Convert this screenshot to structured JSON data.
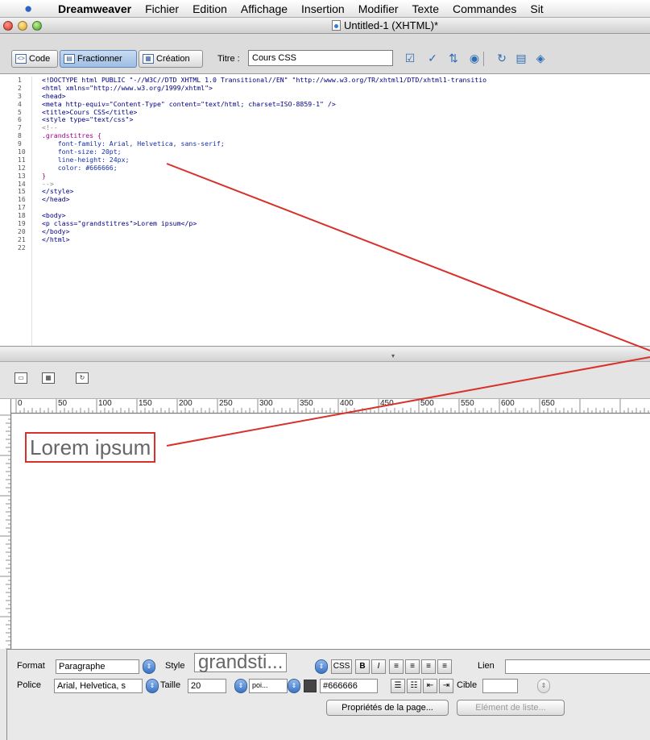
{
  "menubar": {
    "items": [
      "Dreamweaver",
      "Fichier",
      "Edition",
      "Affichage",
      "Insertion",
      "Modifier",
      "Texte",
      "Commandes",
      "Sit"
    ]
  },
  "window": {
    "title": "Untitled-1 (XHTML)*"
  },
  "doc_toolbar": {
    "code_label": "Code",
    "split_label": "Fractionner",
    "design_label": "Création",
    "title_label": "Titre :",
    "title_value": "Cours CSS"
  },
  "code": {
    "line_numbers": [
      "1",
      "2",
      "3",
      "4",
      "5",
      "6",
      "7",
      "8",
      "9",
      "10",
      "11",
      "12",
      "13",
      "14",
      "15",
      "16",
      "17",
      "18",
      "19",
      "20",
      "21",
      "22"
    ],
    "lines": [
      "<!DOCTYPE html PUBLIC \"-//W3C//DTD XHTML 1.0 Transitional//EN\" \"http://www.w3.org/TR/xhtml1/DTD/xhtml1-transitio",
      "<html xmlns=\"http://www.w3.org/1999/xhtml\">",
      "<head>",
      "<meta http-equiv=\"Content-Type\" content=\"text/html; charset=ISO-8859-1\" />",
      "<title>Cours CSS</title>",
      "<style type=\"text/css\">",
      "<!--",
      ".grandstitres {",
      "    font-family: Arial, Helvetica, sans-serif;",
      "    font-size: 20pt;",
      "    line-height: 24px;",
      "    color: #666666;",
      "}",
      "-->",
      "</style>",
      "</head>",
      "",
      "<body>",
      "<p class=\"grandstitres\">Lorem ipsum</p>",
      "</body>",
      "</html>",
      ""
    ]
  },
  "ruler": {
    "labels": [
      "0",
      "50",
      "100",
      "150",
      "200",
      "250",
      "300",
      "350",
      "400",
      "450",
      "500",
      "550",
      "600",
      "650"
    ]
  },
  "design": {
    "paragraph_text": "Lorem ipsum"
  },
  "properties": {
    "format_label": "Format",
    "format_value": "Paragraphe",
    "style_label": "Style",
    "style_value": "grandsti...",
    "css_label": "CSS",
    "bold_label": "B",
    "italic_label": "I",
    "link_label": "Lien",
    "font_label": "Police",
    "font_value": "Arial, Helvetica, s",
    "size_label": "Taille",
    "size_value": "20",
    "unit_value": "poi...",
    "color_value": "#666666",
    "target_label": "Cible",
    "page_props_button": "Propriétés de la page...",
    "list_item_button": "Elément de liste..."
  },
  "colors": {
    "annotation": "#d8302a",
    "css_text": "#666666"
  }
}
